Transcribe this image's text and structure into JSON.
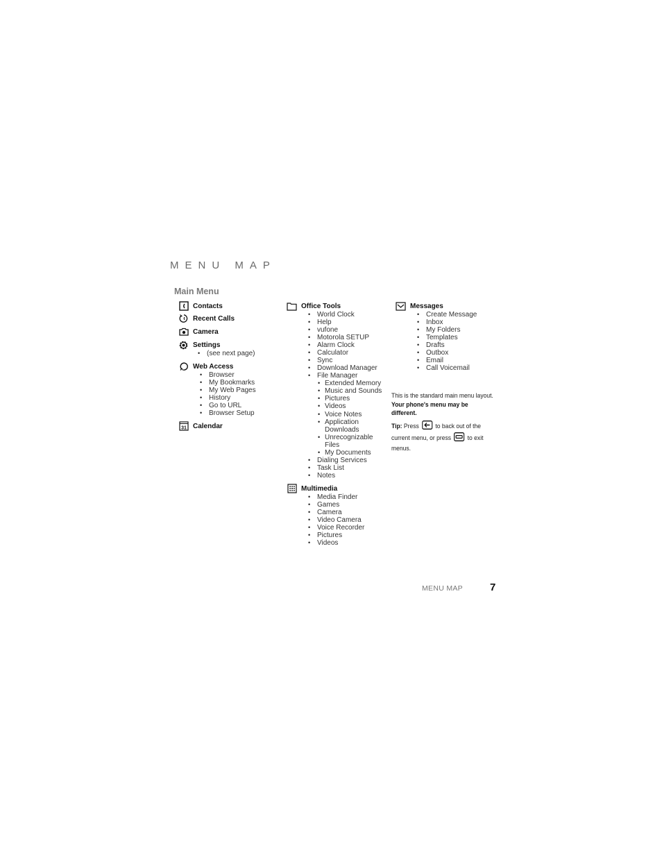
{
  "page": {
    "section_title": "MENU MAP",
    "heading": "Main Menu",
    "footer_label": "MENU MAP",
    "page_number": "7"
  },
  "columns": [
    {
      "categories": [
        {
          "label": "Contacts",
          "icon": "contacts-icon",
          "items": []
        },
        {
          "label": "Recent Calls",
          "icon": "recent-calls-icon",
          "items": []
        },
        {
          "label": "Camera",
          "icon": "camera-icon",
          "items": []
        },
        {
          "label": "Settings",
          "icon": "settings-icon",
          "items": [
            "(see next page)"
          ]
        },
        {
          "label": "Web Access",
          "icon": "web-access-icon",
          "items": [
            "Browser",
            "My Bookmarks",
            "My Web Pages",
            "History",
            "Go to URL",
            "Browser Setup"
          ]
        },
        {
          "label": "Calendar",
          "icon": "calendar-icon",
          "items": []
        }
      ]
    },
    {
      "categories": [
        {
          "label": "Office Tools",
          "icon": "office-tools-icon",
          "items": [
            "World Clock",
            "Help",
            "vufone",
            "Motorola SETUP",
            "Alarm Clock",
            "Calculator",
            "Sync",
            "Download Manager",
            "File Manager",
            "Dialing Services",
            "Task List",
            "Notes"
          ],
          "file_manager_sub": [
            "Extended Memory",
            "Music and Sounds",
            "Pictures",
            "Videos",
            "Voice Notes",
            "Application Downloads",
            "Unrecognizable Files",
            "My Documents"
          ]
        },
        {
          "label": "Multimedia",
          "icon": "multimedia-icon",
          "items": [
            "Media Finder",
            "Games",
            "Camera",
            "Video Camera",
            "Voice Recorder",
            "Pictures",
            "Videos"
          ]
        }
      ]
    },
    {
      "categories": [
        {
          "label": "Messages",
          "icon": "messages-icon",
          "items": [
            "Create Message",
            "Inbox",
            "My Folders",
            "Templates",
            "Drafts",
            "Outbox",
            "Email",
            "Call Voicemail"
          ]
        }
      ]
    }
  ],
  "note": {
    "text_1": "This is the standard main menu layout.",
    "text_1_bold": "Your phone's menu may be different.",
    "tip_label": "Tip:",
    "tip_text_a": "Press",
    "tip_text_b": "to back out of the current menu, or press",
    "tip_text_c": "to exit menus.",
    "back_key_icon": "back-key-icon",
    "end_key_icon": "end-key-icon"
  }
}
